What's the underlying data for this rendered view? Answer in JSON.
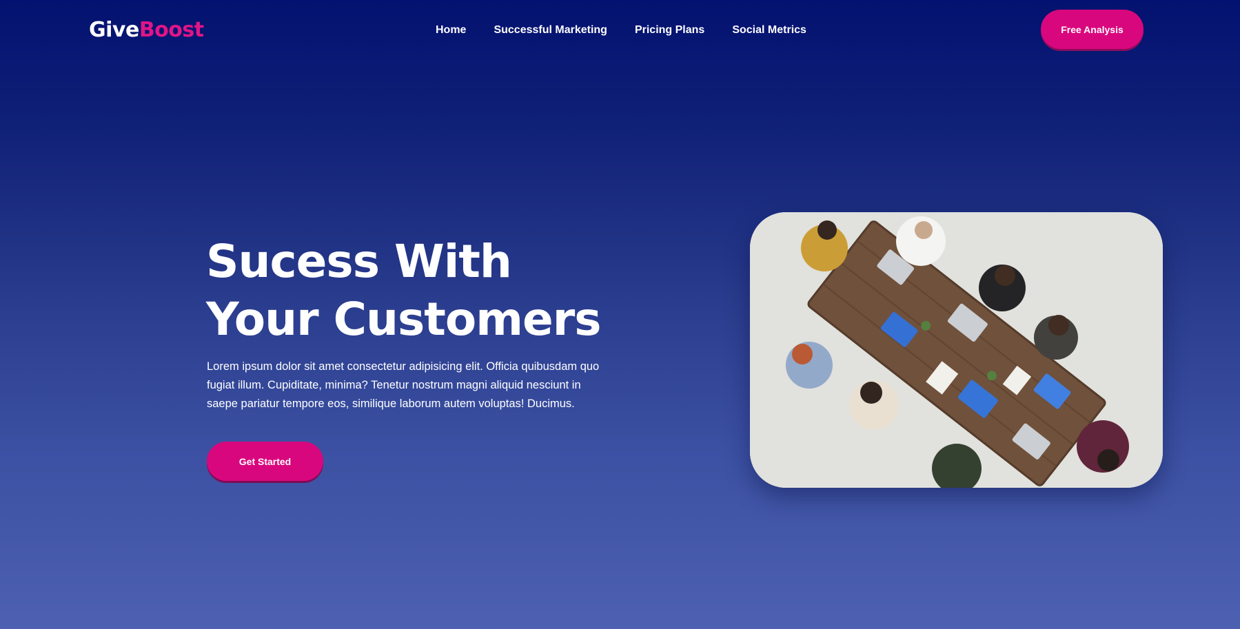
{
  "brand": {
    "part1": "Give",
    "part2": "Boost",
    "accent_color": "#e01587"
  },
  "nav": {
    "items": [
      {
        "label": "Home"
      },
      {
        "label": "Successful Marketing"
      },
      {
        "label": "Pricing Plans"
      },
      {
        "label": "Social Metrics"
      }
    ]
  },
  "header_cta": {
    "label": "Free Analysis"
  },
  "hero": {
    "title_line1": "Sucess With",
    "title_line2": "Your Customers",
    "description": "Lorem ipsum dolor sit amet consectetur adipisicing elit. Officia quibusdam quo fugiat illum. Cupiditate, minima? Tenetur nostrum magni aliquid nesciunt in saepe pariatur tempore eos, similique laborum autem voluptas! Ducimus.",
    "cta_label": "Get Started",
    "image_subject": "team-meeting-overhead-photo"
  },
  "colors": {
    "background_top": "#031170",
    "background_bottom": "#4d60b1",
    "button": "#d9077d"
  }
}
